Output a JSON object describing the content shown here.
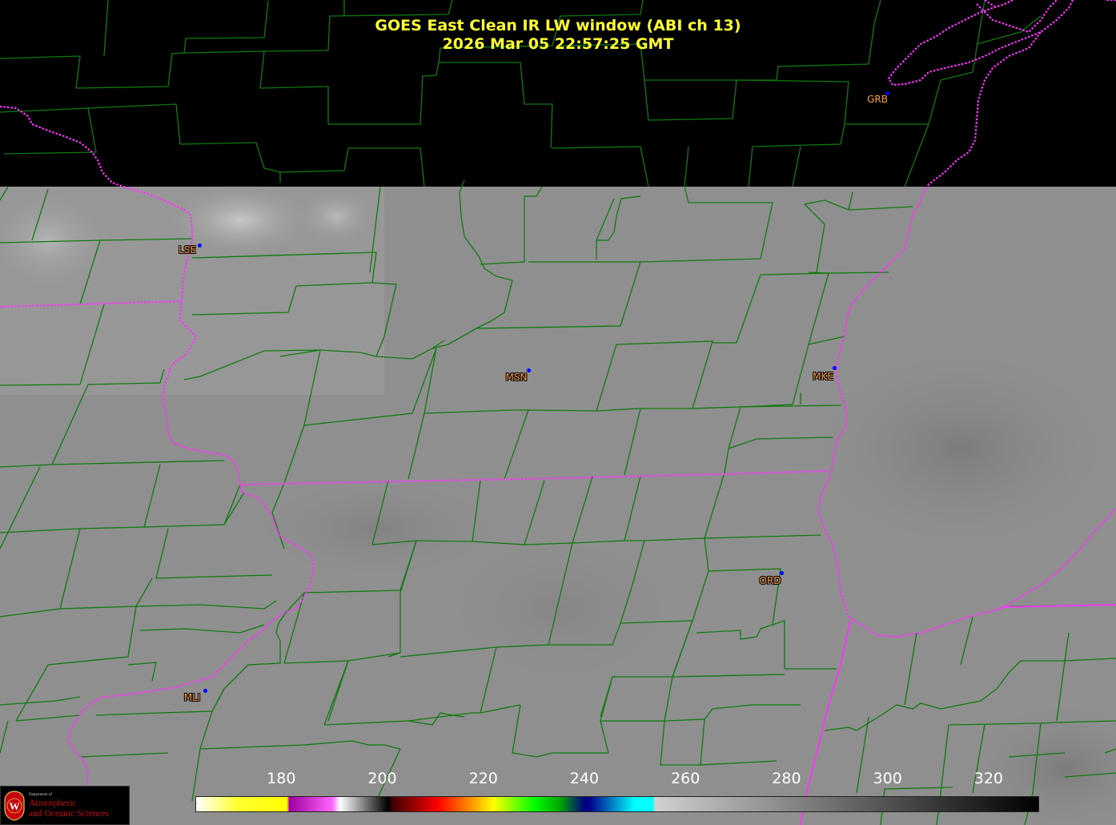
{
  "title": {
    "line1": "GOES East Clean IR LW window (ABI ch 13)",
    "line2": "2026 Mar 05  22:57:25 GMT"
  },
  "colors": {
    "background": "#000000",
    "ir_field": "#8e8e8e",
    "county_lines": "#0f7a0f",
    "state_lines": "#ff33ff",
    "title_text": "#ffff33",
    "station_label": "#ff9d3b",
    "station_dot": "#0000ff"
  },
  "stations": [
    {
      "id": "GRB"
    },
    {
      "id": "LSE"
    },
    {
      "id": "MSN"
    },
    {
      "id": "MKE"
    },
    {
      "id": "ORD"
    },
    {
      "id": "MLI"
    }
  ],
  "colorbar": {
    "unit_values": [
      "180",
      "200",
      "220",
      "240",
      "260",
      "280",
      "300",
      "320"
    ],
    "range": [
      163,
      330
    ]
  },
  "logo": {
    "dept": "Department of",
    "line1": "Atmospheric",
    "line2": "and Oceanic Sciences",
    "seal_letter": "W"
  }
}
